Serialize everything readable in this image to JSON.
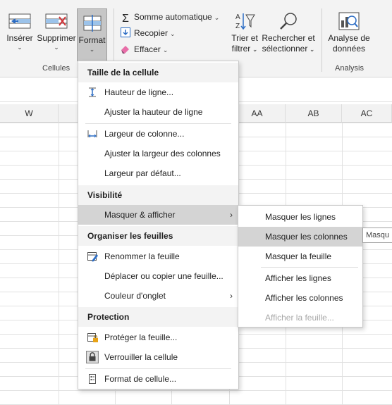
{
  "ribbon": {
    "insert": "Insérer",
    "delete": "Supprimer",
    "format": "Format",
    "cells_group": "Cellules",
    "autosum": "Somme automatique",
    "fill": "Recopier",
    "clear": "Effacer",
    "sort_line1": "Trier et",
    "sort_line2": "filtrer",
    "find_line1": "Rechercher et",
    "find_line2": "sélectionner",
    "analyze_line1": "Analyse de",
    "analyze_line2": "données",
    "analysis_group": "Analysis"
  },
  "columns": [
    "W",
    "AA",
    "AB",
    "AC"
  ],
  "menu": {
    "cell_size_header": "Taille de la cellule",
    "row_height": "Hauteur de ligne...",
    "autofit_row": "Ajuster la hauteur de ligne",
    "column_width": "Largeur de colonne...",
    "autofit_column": "Ajuster la largeur des colonnes",
    "default_width": "Largeur par défaut...",
    "visibility_header": "Visibilité",
    "hide_unhide": "Masquer & afficher",
    "organize_header": "Organiser les feuilles",
    "rename_sheet": "Renommer la feuille",
    "move_copy": "Déplacer ou copier une feuille...",
    "tab_color": "Couleur d'onglet",
    "protection_header": "Protection",
    "protect_sheet": "Protéger la feuille...",
    "lock_cell": "Verrouiller la cellule",
    "format_cells": "Format de cellule..."
  },
  "submenu": {
    "hide_rows": "Masquer les lignes",
    "hide_columns": "Masquer les colonnes",
    "hide_sheet": "Masquer la feuille",
    "show_rows": "Afficher les lignes",
    "show_columns": "Afficher les colonnes",
    "show_sheet": "Afficher la feuille..."
  },
  "tooltip": "Masqu",
  "colors": {
    "ribbon_bg": "#f3f3f3",
    "active_button": "#c6c6c6",
    "menu_highlight": "#d4d4d4",
    "header_bg": "#f3f3f3",
    "accent_blue": "#2b6cc4",
    "delete_red": "#d13438",
    "disabled_text": "#a8a8a8"
  }
}
